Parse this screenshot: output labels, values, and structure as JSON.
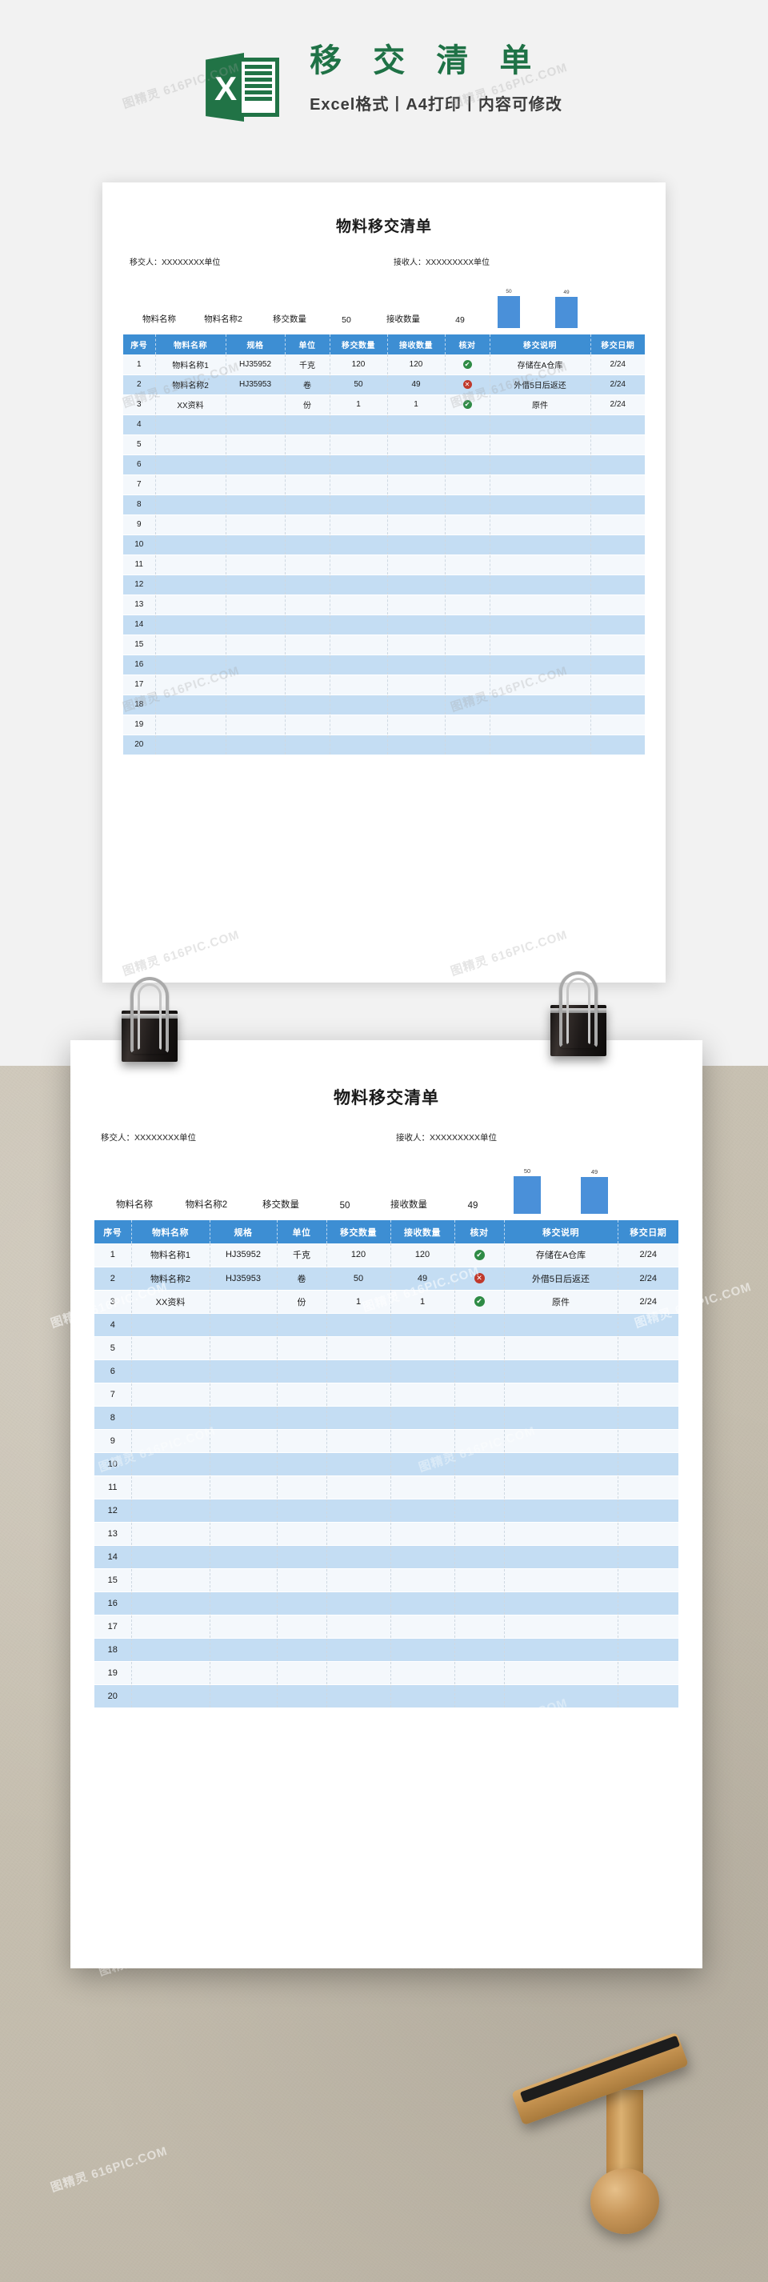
{
  "promo": {
    "logo_letter": "X",
    "title": "移 交 清 单",
    "subtitle": "Excel格式丨A4打印丨内容可修改",
    "brand_green": "#217346"
  },
  "document": {
    "title": "物料移交清单",
    "sender_label": "移交人：XXXXXXXX单位",
    "receiver_label": "接收人：XXXXXXXXX单位",
    "summary": {
      "name_label": "物料名称",
      "name_value": "物料名称2",
      "out_label": "移交数量",
      "out_value": "50",
      "in_label": "接收数量",
      "in_value": "49"
    },
    "table": {
      "headers": [
        "序号",
        "物料名称",
        "规格",
        "单位",
        "移交数量",
        "接收数量",
        "核对",
        "移交说明",
        "移交日期"
      ],
      "rows": [
        {
          "idx": "1",
          "name": "物料名称1",
          "spec": "HJ35952",
          "unit": "千克",
          "out": "120",
          "in": "120",
          "check": "ok",
          "desc": "存储在A仓库",
          "date": "2/24"
        },
        {
          "idx": "2",
          "name": "物料名称2",
          "spec": "HJ35953",
          "unit": "卷",
          "out": "50",
          "in": "49",
          "check": "no",
          "desc": "外借5日后返还",
          "date": "2/24"
        },
        {
          "idx": "3",
          "name": "XX资料",
          "spec": "",
          "unit": "份",
          "out": "1",
          "in": "1",
          "check": "ok",
          "desc": "原件",
          "date": "2/24"
        },
        {
          "idx": "4",
          "name": "",
          "spec": "",
          "unit": "",
          "out": "",
          "in": "",
          "check": "",
          "desc": "",
          "date": ""
        },
        {
          "idx": "5",
          "name": "",
          "spec": "",
          "unit": "",
          "out": "",
          "in": "",
          "check": "",
          "desc": "",
          "date": ""
        },
        {
          "idx": "6",
          "name": "",
          "spec": "",
          "unit": "",
          "out": "",
          "in": "",
          "check": "",
          "desc": "",
          "date": ""
        },
        {
          "idx": "7",
          "name": "",
          "spec": "",
          "unit": "",
          "out": "",
          "in": "",
          "check": "",
          "desc": "",
          "date": ""
        },
        {
          "idx": "8",
          "name": "",
          "spec": "",
          "unit": "",
          "out": "",
          "in": "",
          "check": "",
          "desc": "",
          "date": ""
        },
        {
          "idx": "9",
          "name": "",
          "spec": "",
          "unit": "",
          "out": "",
          "in": "",
          "check": "",
          "desc": "",
          "date": ""
        },
        {
          "idx": "10",
          "name": "",
          "spec": "",
          "unit": "",
          "out": "",
          "in": "",
          "check": "",
          "desc": "",
          "date": ""
        },
        {
          "idx": "11",
          "name": "",
          "spec": "",
          "unit": "",
          "out": "",
          "in": "",
          "check": "",
          "desc": "",
          "date": ""
        },
        {
          "idx": "12",
          "name": "",
          "spec": "",
          "unit": "",
          "out": "",
          "in": "",
          "check": "",
          "desc": "",
          "date": ""
        },
        {
          "idx": "13",
          "name": "",
          "spec": "",
          "unit": "",
          "out": "",
          "in": "",
          "check": "",
          "desc": "",
          "date": ""
        },
        {
          "idx": "14",
          "name": "",
          "spec": "",
          "unit": "",
          "out": "",
          "in": "",
          "check": "",
          "desc": "",
          "date": ""
        },
        {
          "idx": "15",
          "name": "",
          "spec": "",
          "unit": "",
          "out": "",
          "in": "",
          "check": "",
          "desc": "",
          "date": ""
        },
        {
          "idx": "16",
          "name": "",
          "spec": "",
          "unit": "",
          "out": "",
          "in": "",
          "check": "",
          "desc": "",
          "date": ""
        },
        {
          "idx": "17",
          "name": "",
          "spec": "",
          "unit": "",
          "out": "",
          "in": "",
          "check": "",
          "desc": "",
          "date": ""
        },
        {
          "idx": "18",
          "name": "",
          "spec": "",
          "unit": "",
          "out": "",
          "in": "",
          "check": "",
          "desc": "",
          "date": ""
        },
        {
          "idx": "19",
          "name": "",
          "spec": "",
          "unit": "",
          "out": "",
          "in": "",
          "check": "",
          "desc": "",
          "date": ""
        },
        {
          "idx": "20",
          "name": "",
          "spec": "",
          "unit": "",
          "out": "",
          "in": "",
          "check": "",
          "desc": "",
          "date": ""
        }
      ]
    },
    "check_ok_glyph": "✔",
    "check_no_glyph": "✕",
    "header_blue": "#3d8ed3",
    "row_blue": "#c4ddf3"
  },
  "chart_data": {
    "type": "bar",
    "categories": [
      "移交数量",
      "接收数量"
    ],
    "values": [
      50,
      49
    ],
    "title": "",
    "xlabel": "",
    "ylabel": "",
    "ylim": [
      0,
      55
    ],
    "grid": false,
    "legend": "none",
    "bar_color": "#4a90d9",
    "data_labels": [
      "50",
      "49"
    ]
  },
  "watermarks": {
    "text": "图精灵 616PIC.COM"
  }
}
